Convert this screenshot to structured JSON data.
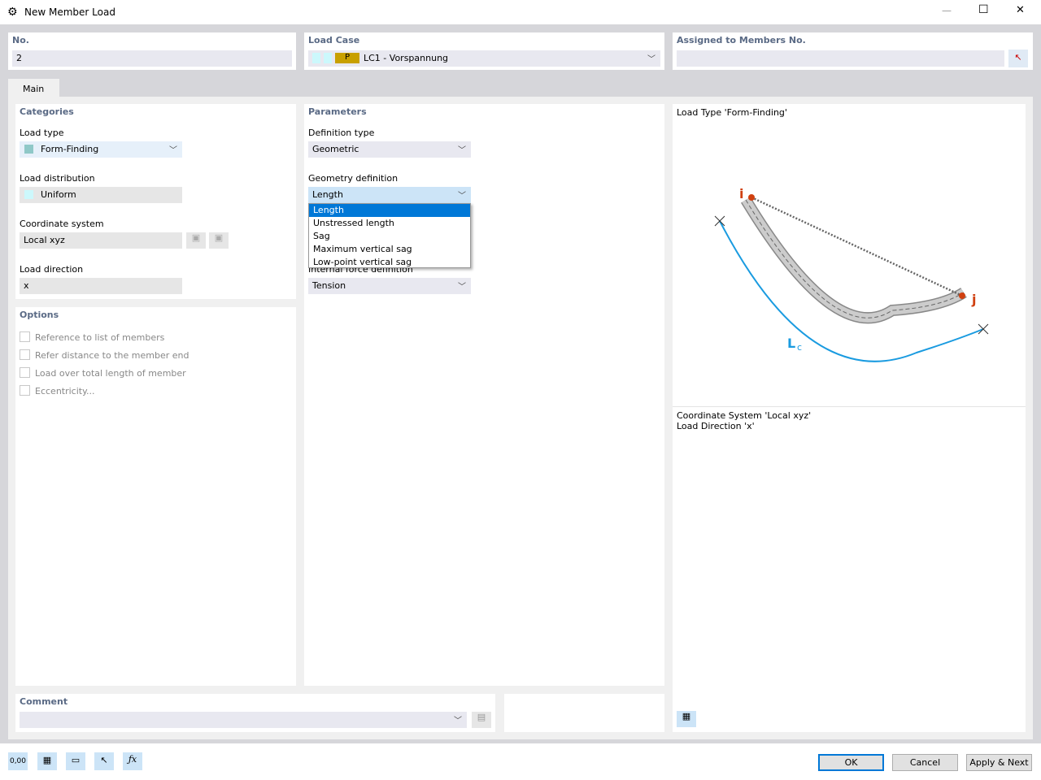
{
  "window": {
    "title": "New Member Load",
    "minimize": "—",
    "maximize": "☐",
    "close": "✕"
  },
  "top": {
    "no_label": "No.",
    "no_value": "2",
    "load_case_label": "Load Case",
    "load_case_tag": "P",
    "load_case_value": "LC1 - Vorspannung",
    "assigned_label": "Assigned to Members No.",
    "assigned_value": ""
  },
  "tabs": [
    {
      "label": "Main"
    }
  ],
  "categories": {
    "title": "Categories",
    "load_type_label": "Load type",
    "load_type": "Form-Finding",
    "load_dist_label": "Load distribution",
    "load_dist": "Uniform",
    "coord_label": "Coordinate system",
    "coord": "Local xyz",
    "dir_label": "Load direction",
    "dir": "x"
  },
  "options": {
    "title": "Options",
    "items": [
      "Reference to list of members",
      "Refer distance to the member end",
      "Load over total length of member",
      "Eccentricity..."
    ]
  },
  "parameters": {
    "title": "Parameters",
    "def_type_label": "Definition type",
    "def_type": "Geometric",
    "geom_label": "Geometry definition",
    "geom": "Length",
    "geom_options": [
      "Length",
      "Unstressed length",
      "Sag",
      "Maximum vertical sag",
      "Low-point vertical sag"
    ],
    "internal_label": "Internal force definition",
    "internal": "Tension"
  },
  "preview": {
    "title": "Load Type 'Form-Finding'",
    "label_i": "i",
    "label_j": "j",
    "label_L": "L",
    "label_L_sub": "c",
    "info1": "Coordinate System 'Local xyz'",
    "info2": "Load Direction 'x'"
  },
  "comment": {
    "label": "Comment",
    "value": ""
  },
  "footer": {
    "ok": "OK",
    "cancel": "Cancel",
    "apply_next": "Apply & Next",
    "units_icon_text": "0,00"
  },
  "colors": {
    "accent": "#0078d7",
    "load_case_tag": "#c8a000",
    "form_finding": "#8fc8c8",
    "curve": "#1a9be0",
    "node": "#d04010"
  }
}
